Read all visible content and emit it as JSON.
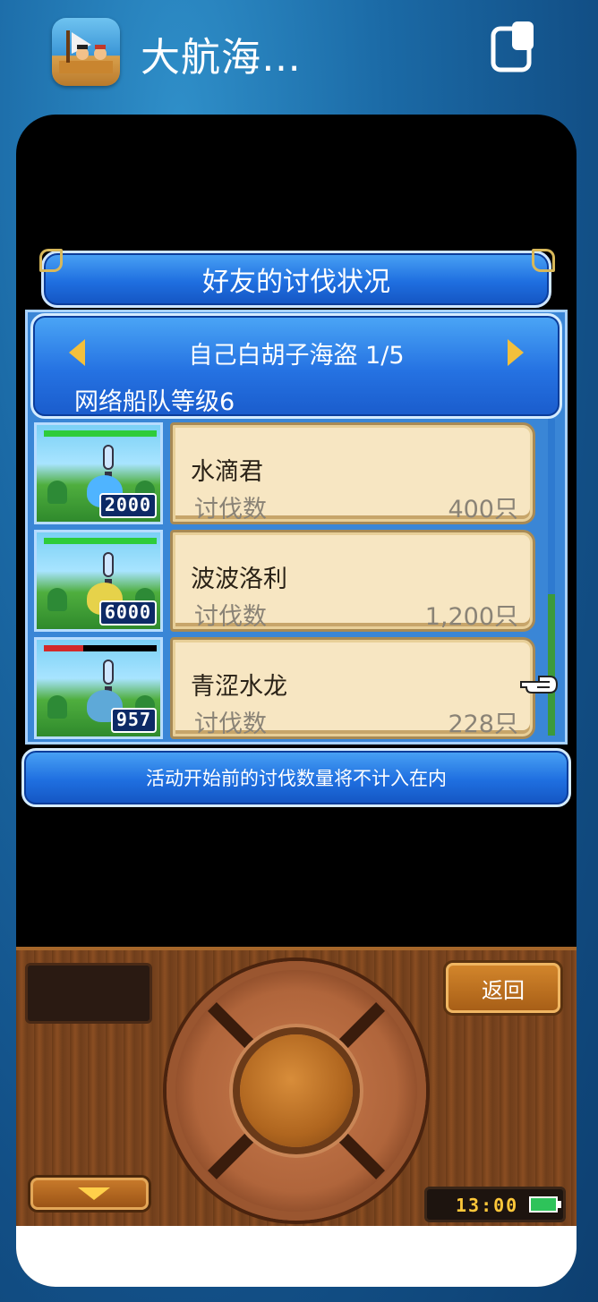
{
  "app": {
    "title": "大航海…",
    "icon": "pirate-ship-app-icon"
  },
  "panel": {
    "title": "好友的讨伐状况",
    "player_name": "自己白胡子海盗 1/5",
    "fleet_level": "网络船队等级6",
    "footer_note": "活动开始前的讨伐数量将不计入在内"
  },
  "rows": [
    {
      "name": "水滴君",
      "label": "讨伐数",
      "count": "400只",
      "badge": "2000",
      "hp_fraction": 1.0,
      "hp_color": "#2ecc3a",
      "monster_color": "#4fb4ff"
    },
    {
      "name": "波波洛利",
      "label": "讨伐数",
      "count": "1,200只",
      "badge": "6000",
      "hp_fraction": 1.0,
      "hp_color": "#2ecc3a",
      "monster_color": "#e6d24a"
    },
    {
      "name": "青涩水龙",
      "label": "讨伐数",
      "count": "228只",
      "badge": "957",
      "hp_fraction": 0.35,
      "hp_color": "#d22a2a",
      "monster_color": "#5ea9d8"
    }
  ],
  "controls": {
    "back_label": "返回",
    "clock": "13:00",
    "battery_level": 1.0
  },
  "colors": {
    "panel_blue": "#1f6fe0",
    "card_bg": "#f7e6c2",
    "wood": "#7d4620",
    "hp_full": "#2ecc3a",
    "hp_low": "#d22a2a"
  }
}
